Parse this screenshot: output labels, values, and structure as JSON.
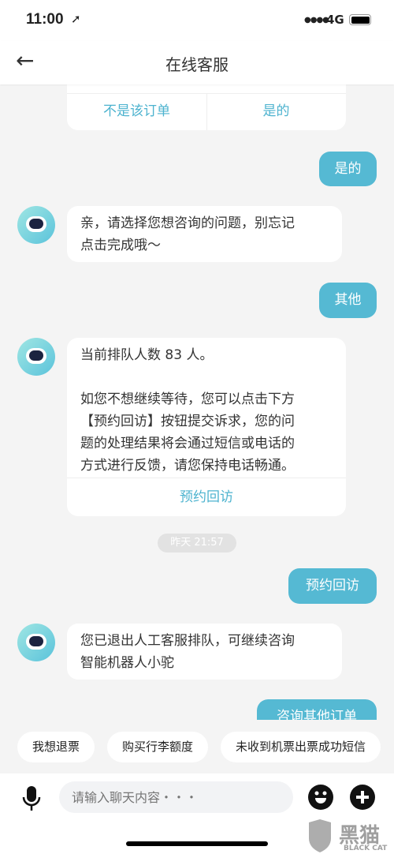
{
  "status_bar": {
    "time": "11:00",
    "network": "4G"
  },
  "nav": {
    "title": "在线客服",
    "back_icon": "arrow-left-icon"
  },
  "top_card": {
    "no_label": "不是该订单",
    "yes_label": "是的"
  },
  "messages": {
    "user1": "是的",
    "bot1": [
      "亲，请选择您想咨询的问题，别忘记",
      "点击完成哦～"
    ],
    "user2": "其他",
    "bot2": {
      "line1": "当前排队人数 83 人。",
      "para": [
        "如您不想继续等待，您可以点击下方",
        "【预约回访】按钮提交诉求，您的问",
        "题的处理结果将会通过短信或电话的",
        "方式进行反馈，请您保持电话畅通。"
      ],
      "action": "预约回访"
    },
    "timestamp": "昨天 21:57",
    "user3": "预约回访",
    "bot3": [
      "您已退出人工客服排队，可继续咨询",
      "智能机器人小驼"
    ],
    "user4": "咨询其他订单"
  },
  "quick_replies": [
    "我想退票",
    "购买行李额度",
    "未收到机票出票成功短信"
  ],
  "input": {
    "placeholder": "请输入聊天内容・・・"
  },
  "watermark": "黑猫 BLACK CAT",
  "colors": {
    "accent": "#55b9d3",
    "background": "#f4f4f4"
  }
}
